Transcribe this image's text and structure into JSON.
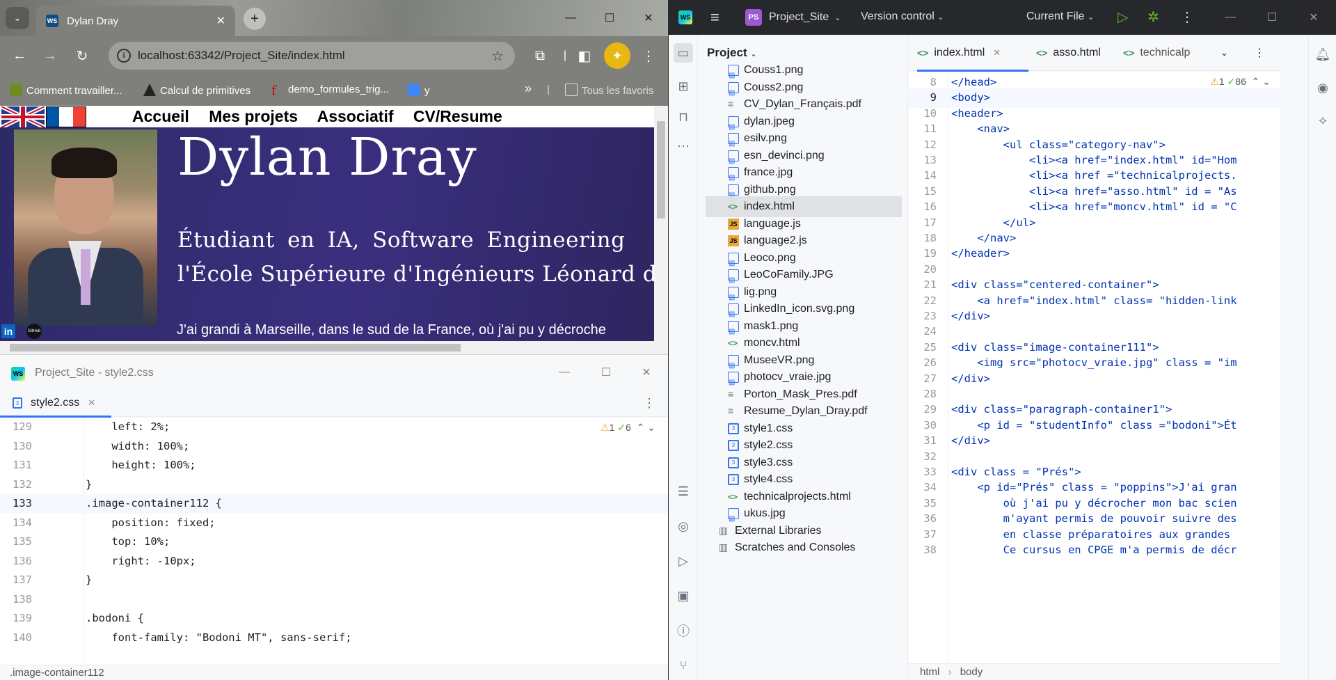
{
  "browser": {
    "tab_title": "Dylan Dray",
    "url": "localhost:63342/Project_Site/index.html",
    "bookmarks": [
      "Comment travailler...",
      "Calcul de primitives",
      "demo_formules_trig...",
      "y",
      "Tous les favoris"
    ]
  },
  "site": {
    "nav_links": [
      "Accueil",
      "Mes projets",
      "Associatif",
      "CV/Resume"
    ],
    "name": "Dylan Dray",
    "subtitle_line1": "Étudiant en IA, Software Engineering",
    "subtitle_line2": "l'École Supérieure d'Ingénieurs Léonard d",
    "intro": "J'ai grandi à Marseille, dans le sud de la France, où j'ai pu y décroche",
    "github_label": "GitHub"
  },
  "css_window": {
    "title": "Project_Site - style2.css",
    "tab": "style2.css",
    "inspection": {
      "warnings": "1",
      "ok": "6"
    },
    "status": ".image-container112",
    "lines": [
      {
        "n": "129",
        "code": "    left: 2%;"
      },
      {
        "n": "130",
        "code": "    width: 100%;"
      },
      {
        "n": "131",
        "code": "    height: 100%;"
      },
      {
        "n": "132",
        "code": "}"
      },
      {
        "n": "133",
        "code": ".image-container112 {"
      },
      {
        "n": "134",
        "code": "    position: fixed;"
      },
      {
        "n": "135",
        "code": "    top: 10%;"
      },
      {
        "n": "136",
        "code": "    right: -10px;"
      },
      {
        "n": "137",
        "code": "}"
      },
      {
        "n": "138",
        "code": ""
      },
      {
        "n": "139",
        "code": ".bodoni {"
      },
      {
        "n": "140",
        "code": "    font-family: \"Bodoni MT\", sans-serif;"
      }
    ]
  },
  "ide": {
    "project": "Project_Site",
    "project_badge": "PS",
    "vcs": "Version control",
    "run_config": "Current File",
    "panel_title": "Project",
    "files": [
      {
        "name": "Couss1.png",
        "type": "img"
      },
      {
        "name": "Couss2.png",
        "type": "img"
      },
      {
        "name": "CV_Dylan_Français.pdf",
        "type": "txt"
      },
      {
        "name": "dylan.jpeg",
        "type": "img"
      },
      {
        "name": "esilv.png",
        "type": "img"
      },
      {
        "name": "esn_devinci.png",
        "type": "img"
      },
      {
        "name": "france.jpg",
        "type": "img"
      },
      {
        "name": "github.png",
        "type": "img"
      },
      {
        "name": "index.html",
        "type": "html"
      },
      {
        "name": "language.js",
        "type": "js"
      },
      {
        "name": "language2.js",
        "type": "js"
      },
      {
        "name": "Leoco.png",
        "type": "img"
      },
      {
        "name": "LeoCoFamily.JPG",
        "type": "img"
      },
      {
        "name": "lig.png",
        "type": "img"
      },
      {
        "name": "LinkedIn_icon.svg.png",
        "type": "img"
      },
      {
        "name": "mask1.png",
        "type": "img"
      },
      {
        "name": "moncv.html",
        "type": "html"
      },
      {
        "name": "MuseeVR.png",
        "type": "img"
      },
      {
        "name": "photocv_vraie.jpg",
        "type": "img"
      },
      {
        "name": "Porton_Mask_Pres.pdf",
        "type": "txt"
      },
      {
        "name": "Resume_Dylan_Dray.pdf",
        "type": "txt"
      },
      {
        "name": "style1.css",
        "type": "css"
      },
      {
        "name": "style2.css",
        "type": "css"
      },
      {
        "name": "style3.css",
        "type": "css"
      },
      {
        "name": "style4.css",
        "type": "css"
      },
      {
        "name": "technicalprojects.html",
        "type": "html"
      },
      {
        "name": "ukus.jpg",
        "type": "img"
      },
      {
        "name": "External Libraries",
        "type": "lib"
      },
      {
        "name": "Scratches and Consoles",
        "type": "lib"
      }
    ],
    "tabs": [
      "index.html",
      "asso.html",
      "technicalp"
    ],
    "inspection": {
      "warnings": "1",
      "ok": "86"
    },
    "breadcrumb": [
      "html",
      "body"
    ],
    "lines": [
      {
        "n": "8",
        "code": "</head>"
      },
      {
        "n": "9",
        "code": "<body>"
      },
      {
        "n": "10",
        "code": "<header>"
      },
      {
        "n": "11",
        "code": "    <nav>"
      },
      {
        "n": "12",
        "code": "        <ul class=\"category-nav\">"
      },
      {
        "n": "13",
        "code": "            <li><a href=\"index.html\" id=\"Hom"
      },
      {
        "n": "14",
        "code": "            <li><a href =\"technicalprojects."
      },
      {
        "n": "15",
        "code": "            <li><a href=\"asso.html\" id = \"As"
      },
      {
        "n": "16",
        "code": "            <li><a href=\"moncv.html\" id = \"C"
      },
      {
        "n": "17",
        "code": "        </ul>"
      },
      {
        "n": "18",
        "code": "    </nav>"
      },
      {
        "n": "19",
        "code": "</header>"
      },
      {
        "n": "20",
        "code": ""
      },
      {
        "n": "21",
        "code": "<div class=\"centered-container\">"
      },
      {
        "n": "22",
        "code": "    <a href=\"index.html\" class= \"hidden-link"
      },
      {
        "n": "23",
        "code": "</div>"
      },
      {
        "n": "24",
        "code": ""
      },
      {
        "n": "25",
        "code": "<div class=\"image-container111\">"
      },
      {
        "n": "26",
        "code": "    <img src=\"photocv_vraie.jpg\" class = \"im"
      },
      {
        "n": "27",
        "code": "</div>"
      },
      {
        "n": "28",
        "code": ""
      },
      {
        "n": "29",
        "code": "<div class=\"paragraph-container1\">"
      },
      {
        "n": "30",
        "code": "    <p id = \"studentInfo\" class =\"bodoni\">Ét"
      },
      {
        "n": "31",
        "code": "</div>"
      },
      {
        "n": "32",
        "code": ""
      },
      {
        "n": "33",
        "code": "<div class = \"Prés\">"
      },
      {
        "n": "34",
        "code": "    <p id=\"Prés\" class = \"poppins\">J'ai gran"
      },
      {
        "n": "35",
        "code": "        où j'ai pu y décrocher mon bac scien"
      },
      {
        "n": "36",
        "code": "        m'ayant permis de pouvoir suivre des"
      },
      {
        "n": "37",
        "code": "        en classe préparatoires aux grandes "
      },
      {
        "n": "38",
        "code": "        Ce cursus en CPGE m'a permis de décr"
      }
    ]
  }
}
